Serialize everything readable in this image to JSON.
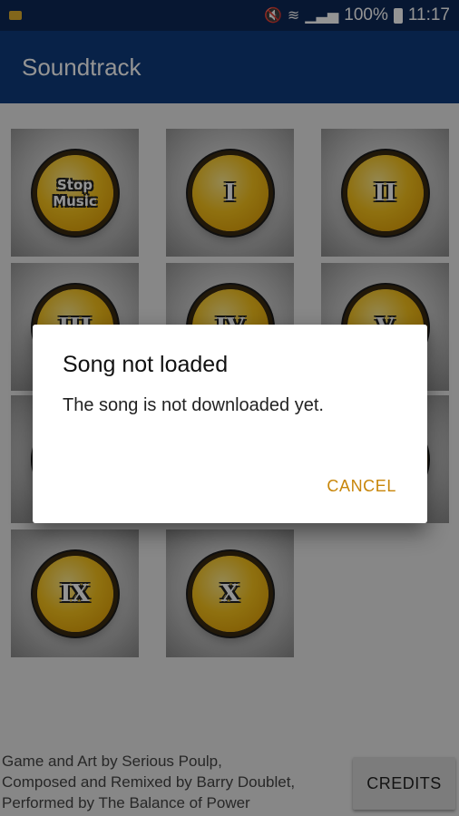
{
  "statusbar": {
    "battery": "100%",
    "time": "11:17",
    "icons": [
      "notification-icon",
      "mute-icon",
      "wifi-icon",
      "signal-icon",
      "battery-icon"
    ]
  },
  "appbar": {
    "title": "Soundtrack"
  },
  "tiles": [
    {
      "label": "Stop Music"
    },
    {
      "label": "I"
    },
    {
      "label": "II"
    },
    {
      "label": "III"
    },
    {
      "label": "IV"
    },
    {
      "label": "V"
    },
    {
      "label": ""
    },
    {
      "label": ""
    },
    {
      "label": ""
    },
    {
      "label": "IX"
    },
    {
      "label": "X"
    }
  ],
  "footer": {
    "text": "Game and Art by Serious Poulp,\nComposed and Remixed by Barry Doublet,\nPerformed by The Balance of Power",
    "credits_label": "CREDITS"
  },
  "dialog": {
    "title": "Song not loaded",
    "message": "The song is not downloaded yet.",
    "cancel_label": "CANCEL"
  },
  "colors": {
    "statusbar": "#0d2957",
    "appbar": "#0f3b7c",
    "accent": "#c8860a",
    "cap": "#f6c21c"
  }
}
